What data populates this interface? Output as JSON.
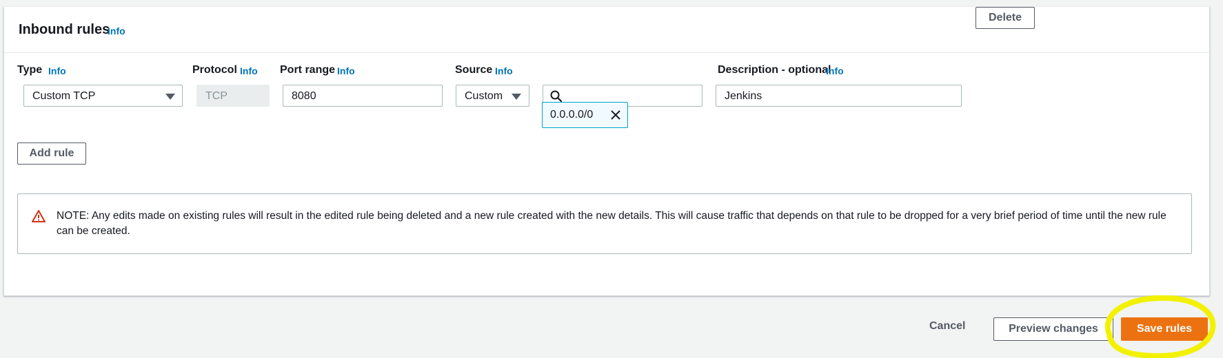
{
  "section": {
    "title": "Inbound rules",
    "info_label": "Info"
  },
  "columns": {
    "type": "Type",
    "protocol": "Protocol",
    "port_range": "Port range",
    "source": "Source",
    "description": "Description - optional",
    "info_label": "Info"
  },
  "rule": {
    "type_value": "Custom TCP",
    "protocol_value": "TCP",
    "port_range_value": "8080",
    "source_type_value": "Custom",
    "source_search_value": "",
    "source_token": "0.0.0.0/0",
    "description_value": "Jenkins",
    "delete_label": "Delete"
  },
  "add_rule_label": "Add rule",
  "note": {
    "text": "NOTE: Any edits made on existing rules will result in the edited rule being deleted and a new rule created with the new details. This will cause traffic that depends on that rule to be dropped for a very brief period of time until the new rule can be created."
  },
  "footer": {
    "cancel_label": "Cancel",
    "preview_label": "Preview changes",
    "save_label": "Save rules"
  },
  "colors": {
    "link": "#0073bb",
    "primary": "#ec7211",
    "warning": "#d13212",
    "token_border": "#00a1c9",
    "highlight": "#f2f200"
  },
  "icons": [
    "caret-down-icon",
    "search-icon",
    "close-icon",
    "warning-icon"
  ]
}
